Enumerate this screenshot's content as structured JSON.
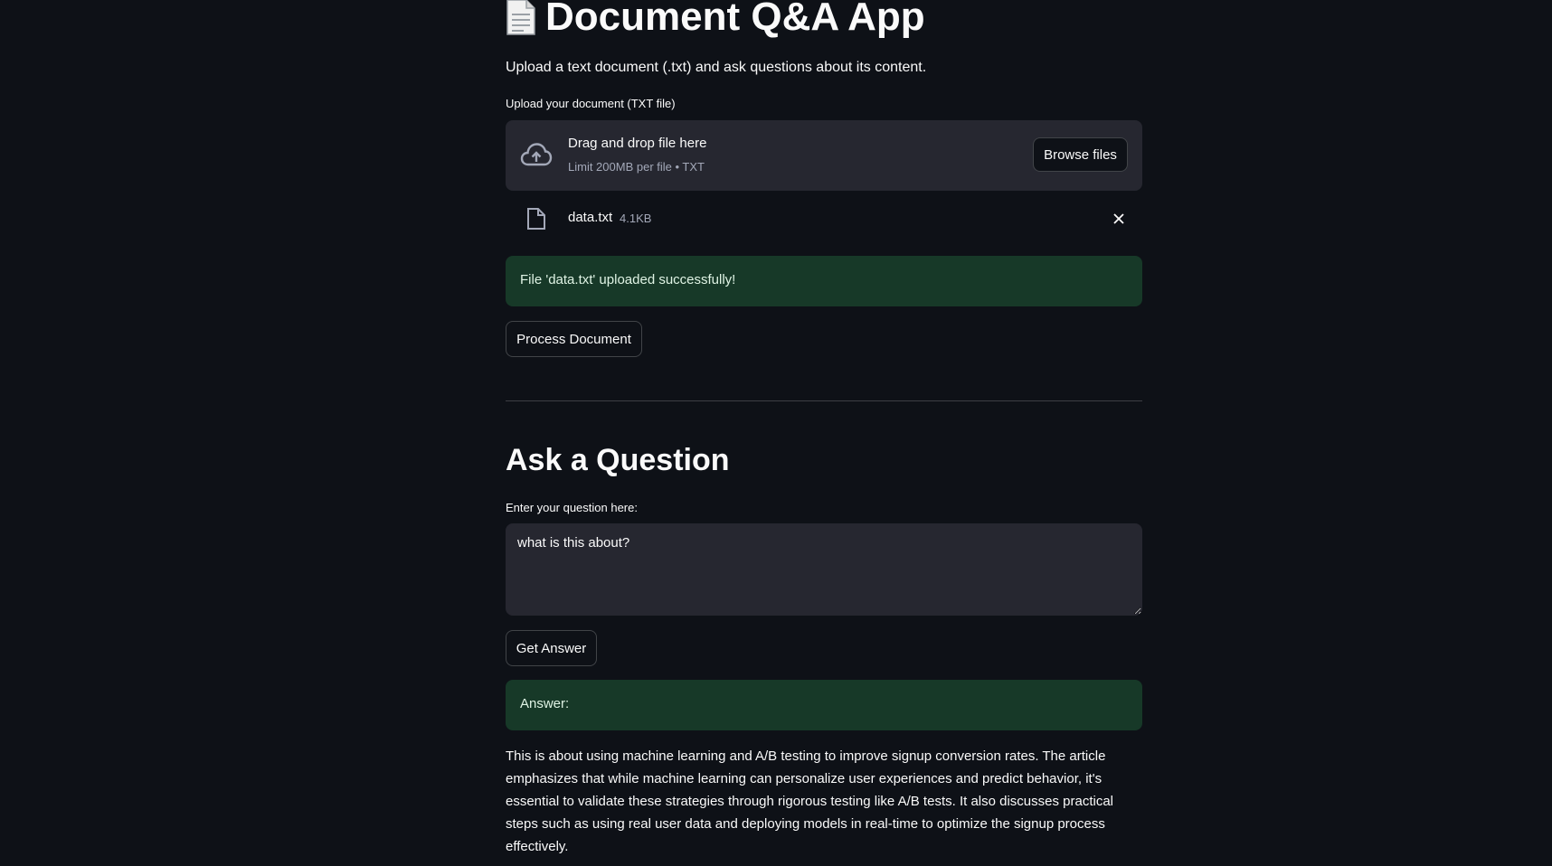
{
  "header": {
    "title": "Document Q&A App",
    "subtitle": "Upload a text document (.txt) and ask questions about its content."
  },
  "uploader": {
    "label": "Upload your document (TXT file)",
    "dropzone_title": "Drag and drop file here",
    "dropzone_limit": "Limit 200MB per file • TXT",
    "browse_label": "Browse files",
    "file": {
      "name": "data.txt",
      "size": "4.1KB"
    }
  },
  "upload_status": {
    "message": "File 'data.txt' uploaded successfully!"
  },
  "process_button": {
    "label": "Process Document"
  },
  "question_section": {
    "heading": "Ask a Question",
    "input_label": "Enter your question here:",
    "input_value": "what is this about?",
    "submit_label": "Get Answer"
  },
  "answer": {
    "label": "Answer:",
    "text": "This is about using machine learning and A/B testing to improve signup conversion rates. The article emphasizes that while machine learning can personalize user experiences and predict behavior, it's essential to validate these strategies through rigorous testing like A/B tests. It also discusses practical steps such as using real user data and deploying models in real-time to optimize the signup process effectively."
  },
  "colors": {
    "background": "#0e1117",
    "panel": "#262730",
    "success_bg": "#173928",
    "text": "#fafafa",
    "muted": "#a3a8b8"
  }
}
